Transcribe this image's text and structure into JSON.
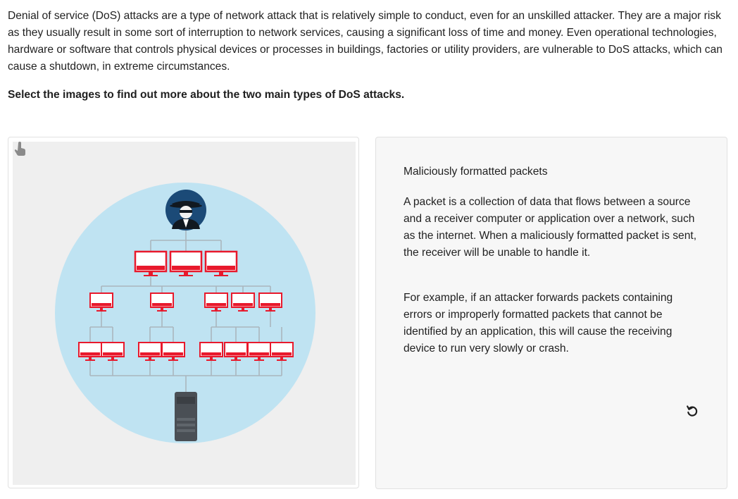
{
  "intro_text": "Denial of service (DoS) attacks are a type of network attack that is relatively simple to conduct, even for an unskilled attacker. They are a major risk as they usually result in some sort of interruption to network services, causing a significant loss of time and money. Even operational technologies, hardware or software that controls physical devices or processes in buildings, factories or utility providers, are vulnerable to DoS attacks, which can cause a shutdown, in extreme circumstances.",
  "instruction_text": "Select the images to find out more about the two main types of DoS attacks.",
  "colors": {
    "circle": "#bfe3f2",
    "computer_red": "#e8192c",
    "line": "#aab6bd",
    "attacker_bg": "#1b4a77",
    "server": "#4a4f55"
  },
  "image_card": {
    "icon": "hacker-network-illustration",
    "hint_icon": "touch-hand-icon"
  },
  "detail_card": {
    "title": "Maliciously formatted packets",
    "paragraph_1": "A packet is a collection of data that flows between a source and a receiver computer or application over a network, such as the internet. When a maliciously formatted packet is sent, the receiver will be unable to handle it.",
    "paragraph_2": "For example, if an attacker forwards packets containing errors or improperly formatted packets that cannot be identified by an application, this will cause the receiving device to run very slowly or crash.",
    "reset_icon": "reset-icon"
  }
}
